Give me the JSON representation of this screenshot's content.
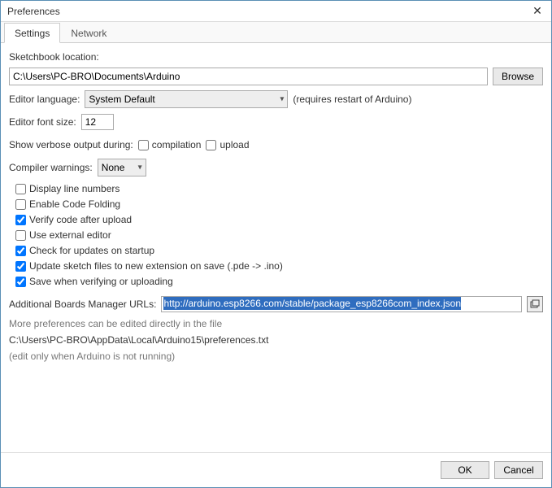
{
  "window": {
    "title": "Preferences"
  },
  "tabs": {
    "settings": "Settings",
    "network": "Network"
  },
  "sketchbook": {
    "label": "Sketchbook location:",
    "path": "C:\\Users\\PC-BRO\\Documents\\Arduino",
    "browse": "Browse"
  },
  "language": {
    "label": "Editor language:",
    "value": "System Default",
    "hint": "(requires restart of Arduino)"
  },
  "font": {
    "label": "Editor font size:",
    "value": "12"
  },
  "verbose": {
    "label": "Show verbose output during:",
    "compilation": "compilation",
    "upload": "upload"
  },
  "warnings": {
    "label": "Compiler warnings:",
    "value": "None"
  },
  "checks": {
    "display_line_numbers": "Display line numbers",
    "enable_code_folding": "Enable Code Folding",
    "verify_after_upload": "Verify code after upload",
    "use_external_editor": "Use external editor",
    "check_updates": "Check for updates on startup",
    "update_sketch_ext": "Update sketch files to new extension on save (.pde -> .ino)",
    "save_when_verify": "Save when verifying or uploading"
  },
  "boards": {
    "label": "Additional Boards Manager URLs:",
    "url": "http://arduino.esp8266.com/stable/package_esp8266com_index.json"
  },
  "notes": {
    "line1": "More preferences can be edited directly in the file",
    "line2": "C:\\Users\\PC-BRO\\AppData\\Local\\Arduino15\\preferences.txt",
    "line3": "(edit only when Arduino is not running)"
  },
  "buttons": {
    "ok": "OK",
    "cancel": "Cancel"
  }
}
